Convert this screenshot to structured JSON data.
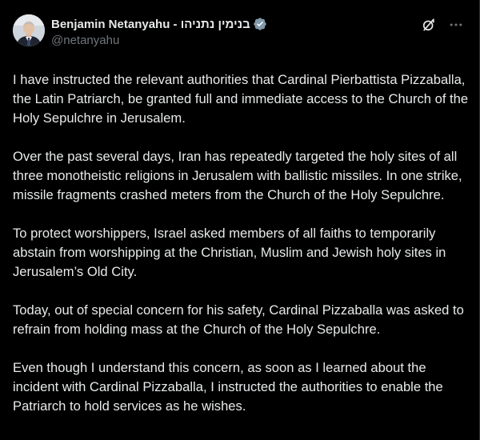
{
  "author": {
    "display_name": "Benjamin Netanyahu - בנימין נתניהו",
    "handle": "@netanyahu",
    "verified_badge": "verified-badge-icon",
    "avatar": "profile-photo"
  },
  "actions": {
    "grok_icon": "grok-icon",
    "more_icon": "more-options-icon"
  },
  "post": {
    "paragraphs": [
      "I have instructed the relevant authorities that Cardinal Pierbattista Pizzaballa, the Latin Patriarch, be granted full and immediate access to the Church of the Holy Sepulchre in Jerusalem.",
      "Over the past several days, Iran has repeatedly targeted the holy sites of all three monotheistic religions in Jerusalem with ballistic missiles. In one strike, missile fragments crashed meters from the Church of the Holy Sepulchre.",
      "To protect worshippers, Israel asked members of all faiths to temporarily abstain from worshipping at the Christian, Muslim and Jewish holy sites in Jerusalem’s Old City.",
      "Today, out of special concern for his safety, Cardinal Pizzaballa was asked to refrain from holding mass at the Church of the Holy Sepulchre.",
      "Even though I understand this concern, as soon as I learned about the incident with Cardinal Pizzaballa, I instructed the authorities to enable the Patriarch to hold services as he wishes."
    ]
  },
  "colors": {
    "background": "#000000",
    "text_primary": "#e7e9ea",
    "text_secondary": "#71767b",
    "verified_gray": "#829aab"
  }
}
